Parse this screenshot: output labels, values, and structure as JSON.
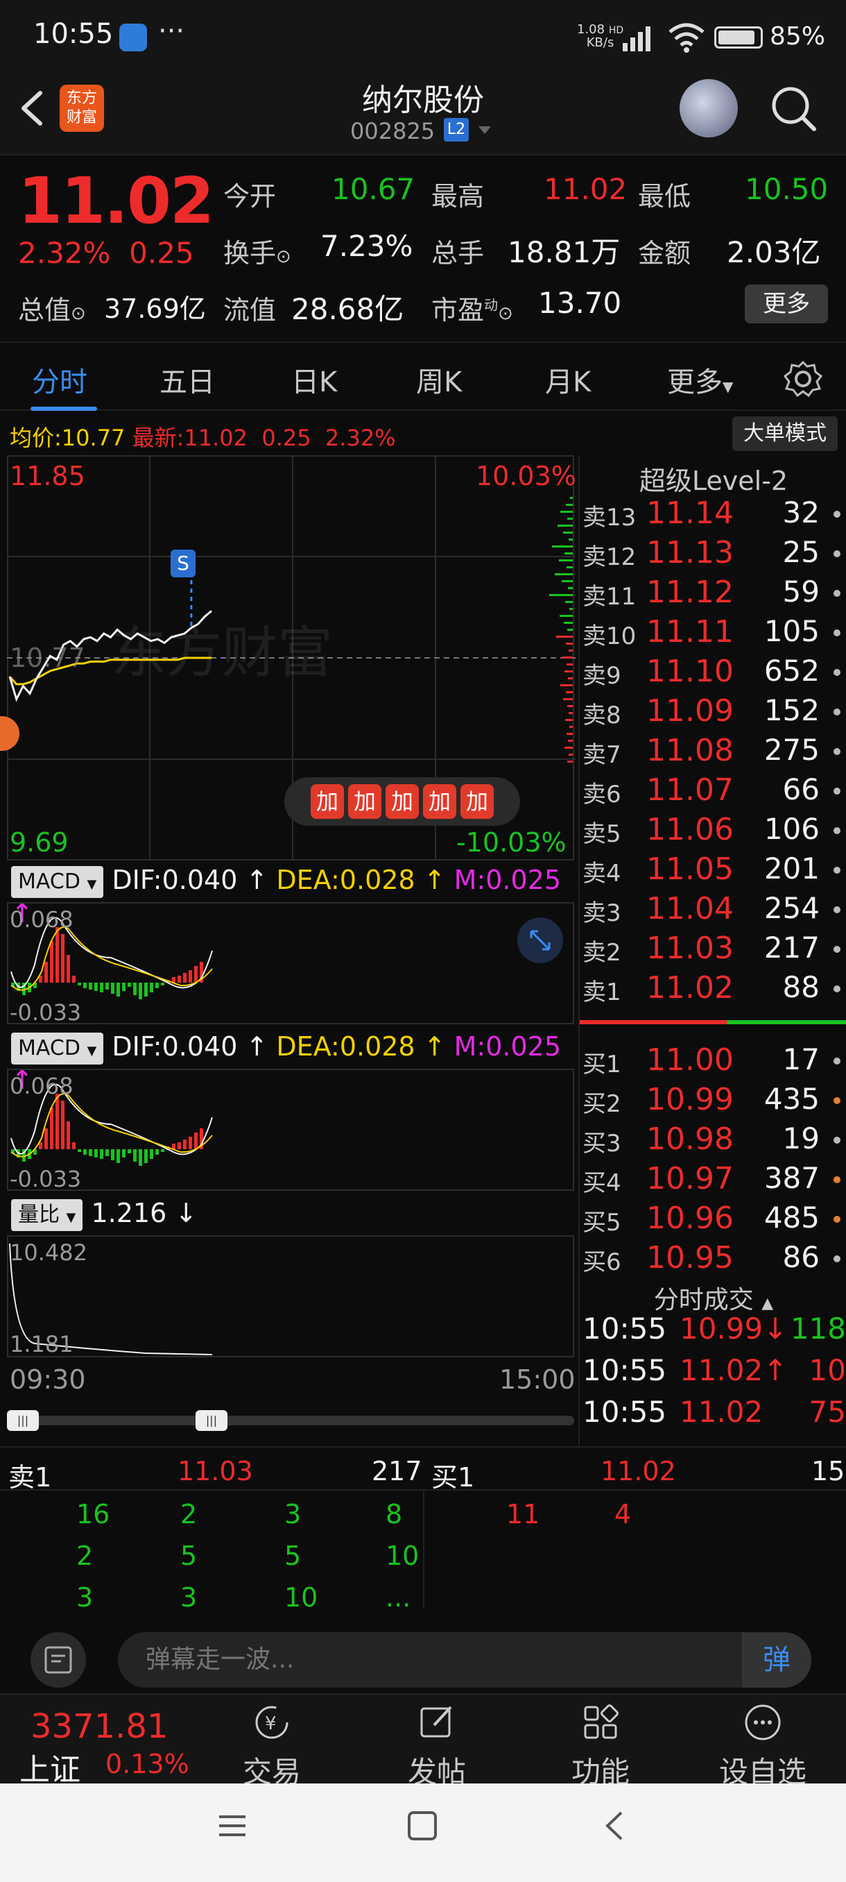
{
  "status_bar": {
    "time": "10:55",
    "net_speed": "1.08",
    "net_unit": "KB/s",
    "net_hd": "HD",
    "battery": "85%"
  },
  "header": {
    "logo_text": "东方财富",
    "stock_name": "纳尔股份",
    "stock_code": "002825",
    "level_badge": "L2"
  },
  "quote": {
    "price": "11.02",
    "change_pct": "2.32%",
    "change": "0.25",
    "open_label": "今开",
    "open": "10.67",
    "high_label": "最高",
    "high": "11.02",
    "low_label": "最低",
    "low": "10.50",
    "turnover_label": "换手",
    "turnover": "7.23%",
    "volume_label": "总手",
    "volume": "18.81万",
    "amount_label": "金额",
    "amount": "2.03亿",
    "mktcap_label": "总值",
    "mktcap": "37.69亿",
    "float_label": "流值",
    "float": "28.68亿",
    "pe_label": "市盈",
    "pe_sup": "动",
    "pe": "13.70",
    "more": "更多"
  },
  "tabs": [
    "分时",
    "五日",
    "日K",
    "周K",
    "月K",
    "更多"
  ],
  "avg_bar": {
    "avg_label": "均价:",
    "avg": "10.77",
    "latest_label": "最新:",
    "latest": "11.02",
    "chg": "0.25",
    "pct": "2.32%",
    "big_order": "大单模式"
  },
  "chart": {
    "top_price": "11.85",
    "bottom_price": "9.69",
    "top_pct": "10.03%",
    "bottom_pct": "-10.03%",
    "ref_price": "10.77",
    "watermark": "东方财富",
    "marker": "S",
    "add_buttons": [
      "加",
      "加",
      "加",
      "加",
      "加"
    ],
    "time_start": "09:30",
    "time_end": "15:00",
    "intraday_prices": [
      10.67,
      10.55,
      10.62,
      10.58,
      10.66,
      10.72,
      10.78,
      10.76,
      10.84,
      10.86,
      10.83,
      10.87,
      10.88,
      10.86,
      10.9,
      10.88,
      10.92,
      10.89,
      10.87,
      10.9,
      10.88,
      10.86,
      10.87,
      10.85,
      10.88,
      10.89,
      10.9,
      10.93,
      10.95,
      10.99,
      11.02
    ],
    "avg_prices": [
      10.67,
      10.63,
      10.63,
      10.64,
      10.66,
      10.68,
      10.7,
      10.71,
      10.72,
      10.73,
      10.74,
      10.74,
      10.75,
      10.75,
      10.75,
      10.76,
      10.76,
      10.76,
      10.76,
      10.76,
      10.76,
      10.76,
      10.76,
      10.76,
      10.76,
      10.76,
      10.77,
      10.77,
      10.77,
      10.77,
      10.77
    ]
  },
  "macd1": {
    "name": "MACD",
    "dif": "DIF:0.040",
    "dea": "DEA:0.028",
    "m": "M:0.025",
    "top": "0.068",
    "bottom": "-0.033"
  },
  "macd2": {
    "name": "MACD",
    "dif": "DIF:0.040",
    "dea": "DEA:0.028",
    "m": "M:0.025",
    "top": "0.068",
    "bottom": "-0.033"
  },
  "vol_ratio": {
    "name": "量比",
    "value": "1.216",
    "top": "10.482",
    "bottom": "1.181"
  },
  "level2": {
    "title": "超级Level-2",
    "asks": [
      {
        "label": "卖13",
        "price": "11.14",
        "vol": "32"
      },
      {
        "label": "卖12",
        "price": "11.13",
        "vol": "25"
      },
      {
        "label": "卖11",
        "price": "11.12",
        "vol": "59"
      },
      {
        "label": "卖10",
        "price": "11.11",
        "vol": "105"
      },
      {
        "label": "卖9",
        "price": "11.10",
        "vol": "652"
      },
      {
        "label": "卖8",
        "price": "11.09",
        "vol": "152"
      },
      {
        "label": "卖7",
        "price": "11.08",
        "vol": "275"
      },
      {
        "label": "卖6",
        "price": "11.07",
        "vol": "66"
      },
      {
        "label": "卖5",
        "price": "11.06",
        "vol": "106"
      },
      {
        "label": "卖4",
        "price": "11.05",
        "vol": "201"
      },
      {
        "label": "卖3",
        "price": "11.04",
        "vol": "254"
      },
      {
        "label": "卖2",
        "price": "11.03",
        "vol": "217"
      },
      {
        "label": "卖1",
        "price": "11.02",
        "vol": "88"
      }
    ],
    "bids": [
      {
        "label": "买1",
        "price": "11.00",
        "vol": "17"
      },
      {
        "label": "买2",
        "price": "10.99",
        "vol": "435"
      },
      {
        "label": "买3",
        "price": "10.98",
        "vol": "19"
      },
      {
        "label": "买4",
        "price": "10.97",
        "vol": "387"
      },
      {
        "label": "买5",
        "price": "10.96",
        "vol": "485"
      },
      {
        "label": "买6",
        "price": "10.95",
        "vol": "86"
      }
    ],
    "ticks_title": "分时成交",
    "ticks": [
      {
        "time": "10:55",
        "price": "10.99↓",
        "vol": "118"
      },
      {
        "time": "10:55",
        "price": "11.02↑",
        "vol": "10"
      },
      {
        "time": "10:55",
        "price": "11.02",
        "vol": "75"
      }
    ]
  },
  "depth": {
    "ask_label": "卖1",
    "ask_price": "11.03",
    "ask_total": "217",
    "bid_label": "买1",
    "bid_price": "11.02",
    "bid_total": "15",
    "ask_orders": [
      [
        "16",
        "2",
        "3",
        "8"
      ],
      [
        "2",
        "5",
        "5",
        "10"
      ],
      [
        "3",
        "3",
        "10",
        "..."
      ]
    ],
    "bid_orders": [
      "11",
      "4"
    ]
  },
  "danmu": {
    "placeholder": "弹幕走一波...",
    "send": "弹"
  },
  "bottom_nav": {
    "index_value": "3371.81",
    "index_name": "上证",
    "index_pct": "0.13%",
    "items": [
      "交易",
      "发帖",
      "功能",
      "设自选"
    ]
  },
  "colors": {
    "up": "#ee2b2b",
    "down": "#19c31e",
    "accent": "#3a8cf0",
    "avg_line": "#f5d000"
  }
}
